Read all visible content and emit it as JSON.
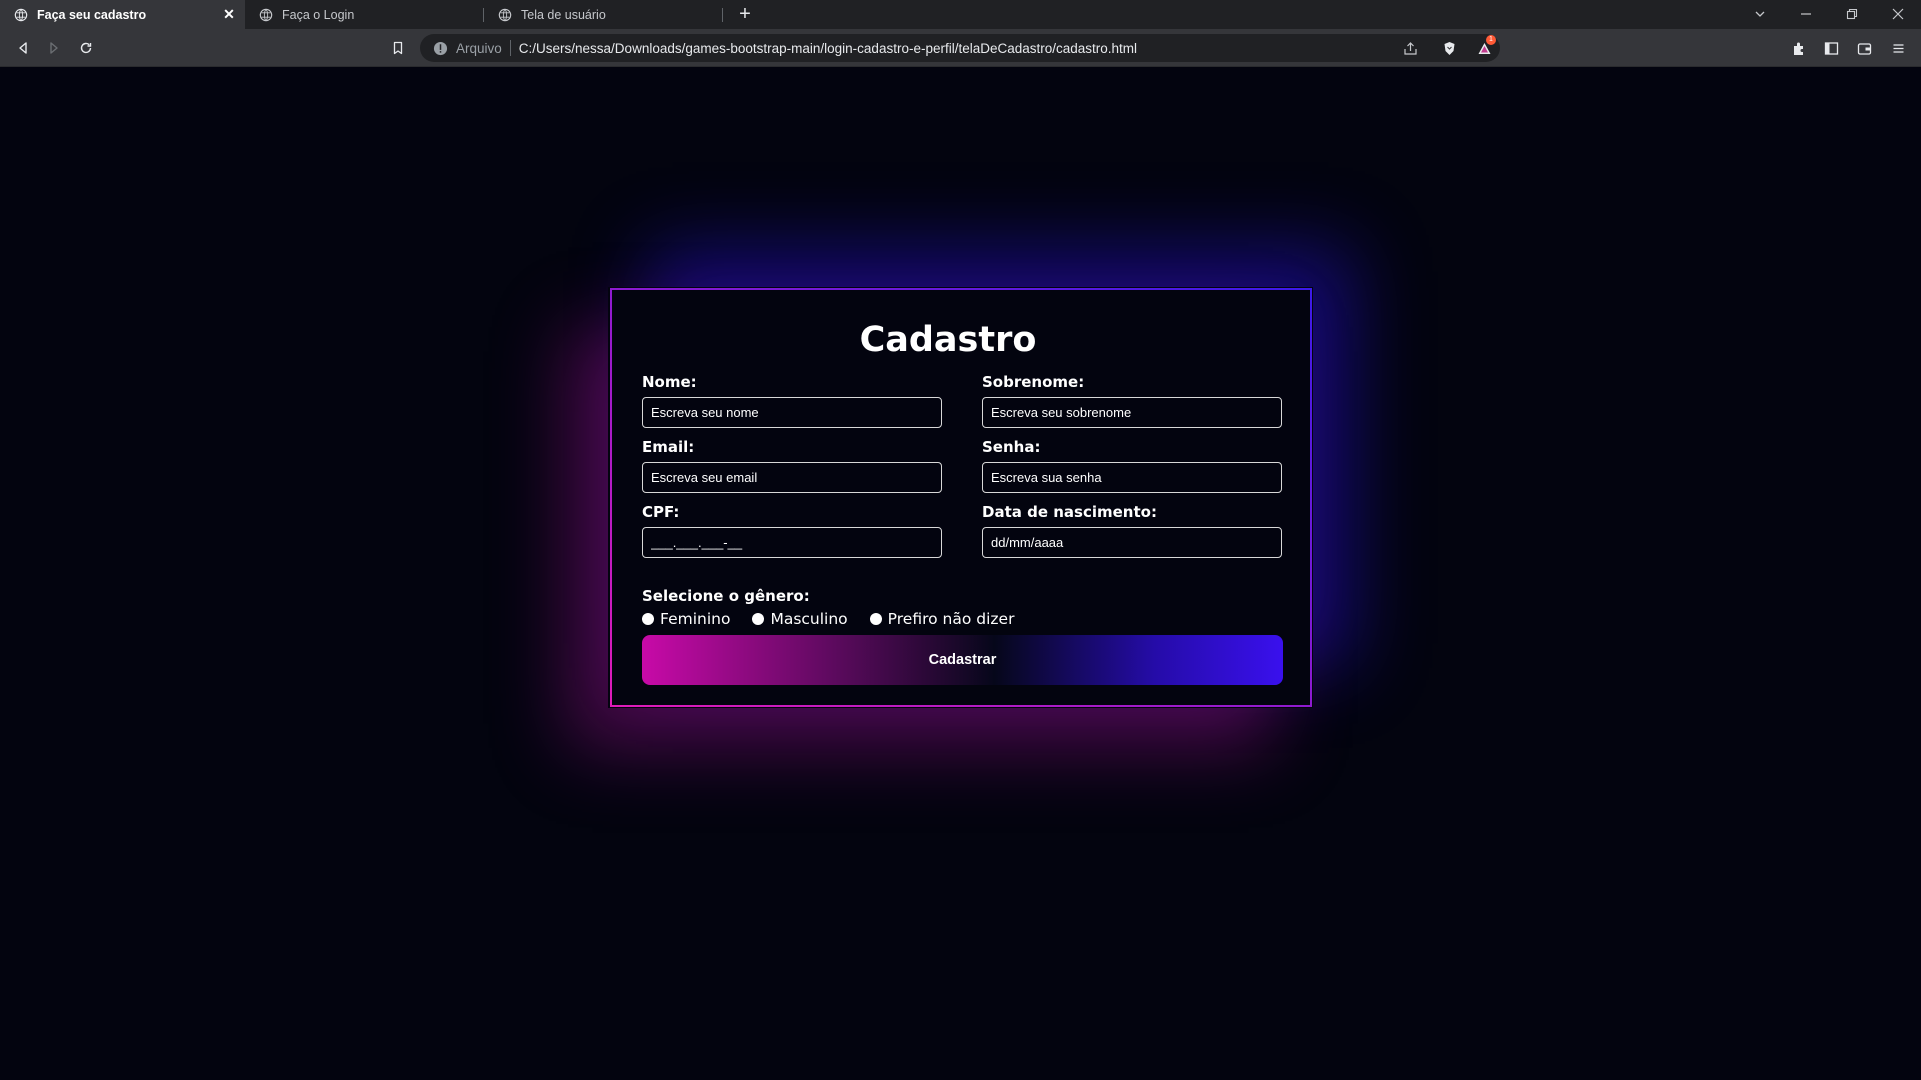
{
  "browser": {
    "tabs": [
      {
        "title": "Faça seu cadastro",
        "active": true
      },
      {
        "title": "Faça o Login",
        "active": false
      },
      {
        "title": "Tela de usuário",
        "active": false
      }
    ],
    "address": {
      "scheme": "Arquivo",
      "url": "C:/Users/nessa/Downloads/games-bootstrap-main/login-cadastro-e-perfil/telaDeCadastro/cadastro.html"
    },
    "shields_badge": "1"
  },
  "form": {
    "title": "Cadastro",
    "nome": {
      "label": "Nome:",
      "placeholder": "Escreva seu nome"
    },
    "sobrenome": {
      "label": "Sobrenome:",
      "placeholder": "Escreva seu sobrenome"
    },
    "email": {
      "label": "Email:",
      "placeholder": "Escreva seu email"
    },
    "senha": {
      "label": "Senha:",
      "placeholder": "Escreva sua senha"
    },
    "cpf": {
      "label": "CPF:",
      "placeholder": "___.___.___-__"
    },
    "nascimento": {
      "label": "Data de nascimento:",
      "placeholder": "dd/mm/aaaa"
    },
    "genero": {
      "title": "Selecione o gênero:",
      "options": [
        "Feminino",
        "Masculino",
        "Prefiro não dizer"
      ]
    },
    "submit_label": "Cadastrar"
  },
  "colors": {
    "background": "#03040f",
    "accent_pink": "#c80aa8",
    "accent_blue": "#3a10ee"
  }
}
